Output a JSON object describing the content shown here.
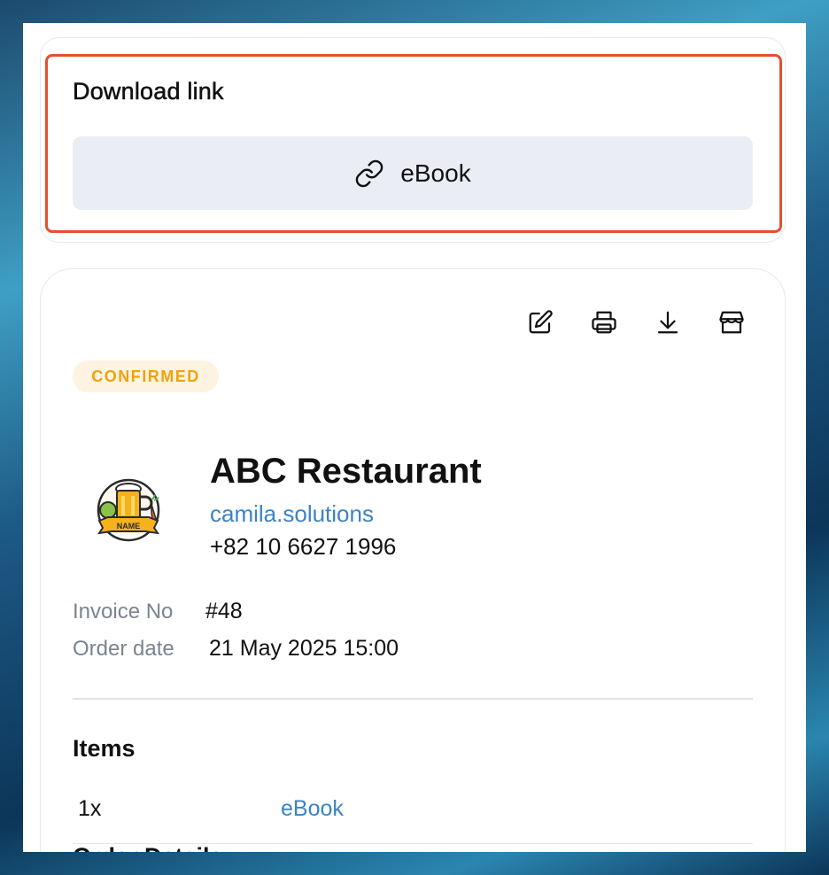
{
  "download": {
    "title": "Download link",
    "button_label": "eBook",
    "button_icon": "link-icon"
  },
  "toolbar": {
    "icons": [
      "edit-icon",
      "printer-icon",
      "download-icon",
      "store-icon"
    ]
  },
  "status": {
    "label": "CONFIRMED",
    "color": "#f0a30a",
    "background": "#fdf3e0"
  },
  "business": {
    "logo_text": "NAME",
    "name": "ABC Restaurant",
    "website": "camila.solutions",
    "phone": "+82 10 6627 1996"
  },
  "invoice": {
    "invoice_no_label": "Invoice No",
    "invoice_no": "#48",
    "order_date_label": "Order date",
    "order_date": "21 May 2025 15:00"
  },
  "items": {
    "title": "Items",
    "rows": [
      {
        "qty": "1x",
        "name": "eBook"
      }
    ]
  },
  "next_section_title": "Order Details",
  "colors": {
    "accent_link": "#3b83c6",
    "highlight": "#e5502f",
    "button_bg": "#eaedf4"
  }
}
